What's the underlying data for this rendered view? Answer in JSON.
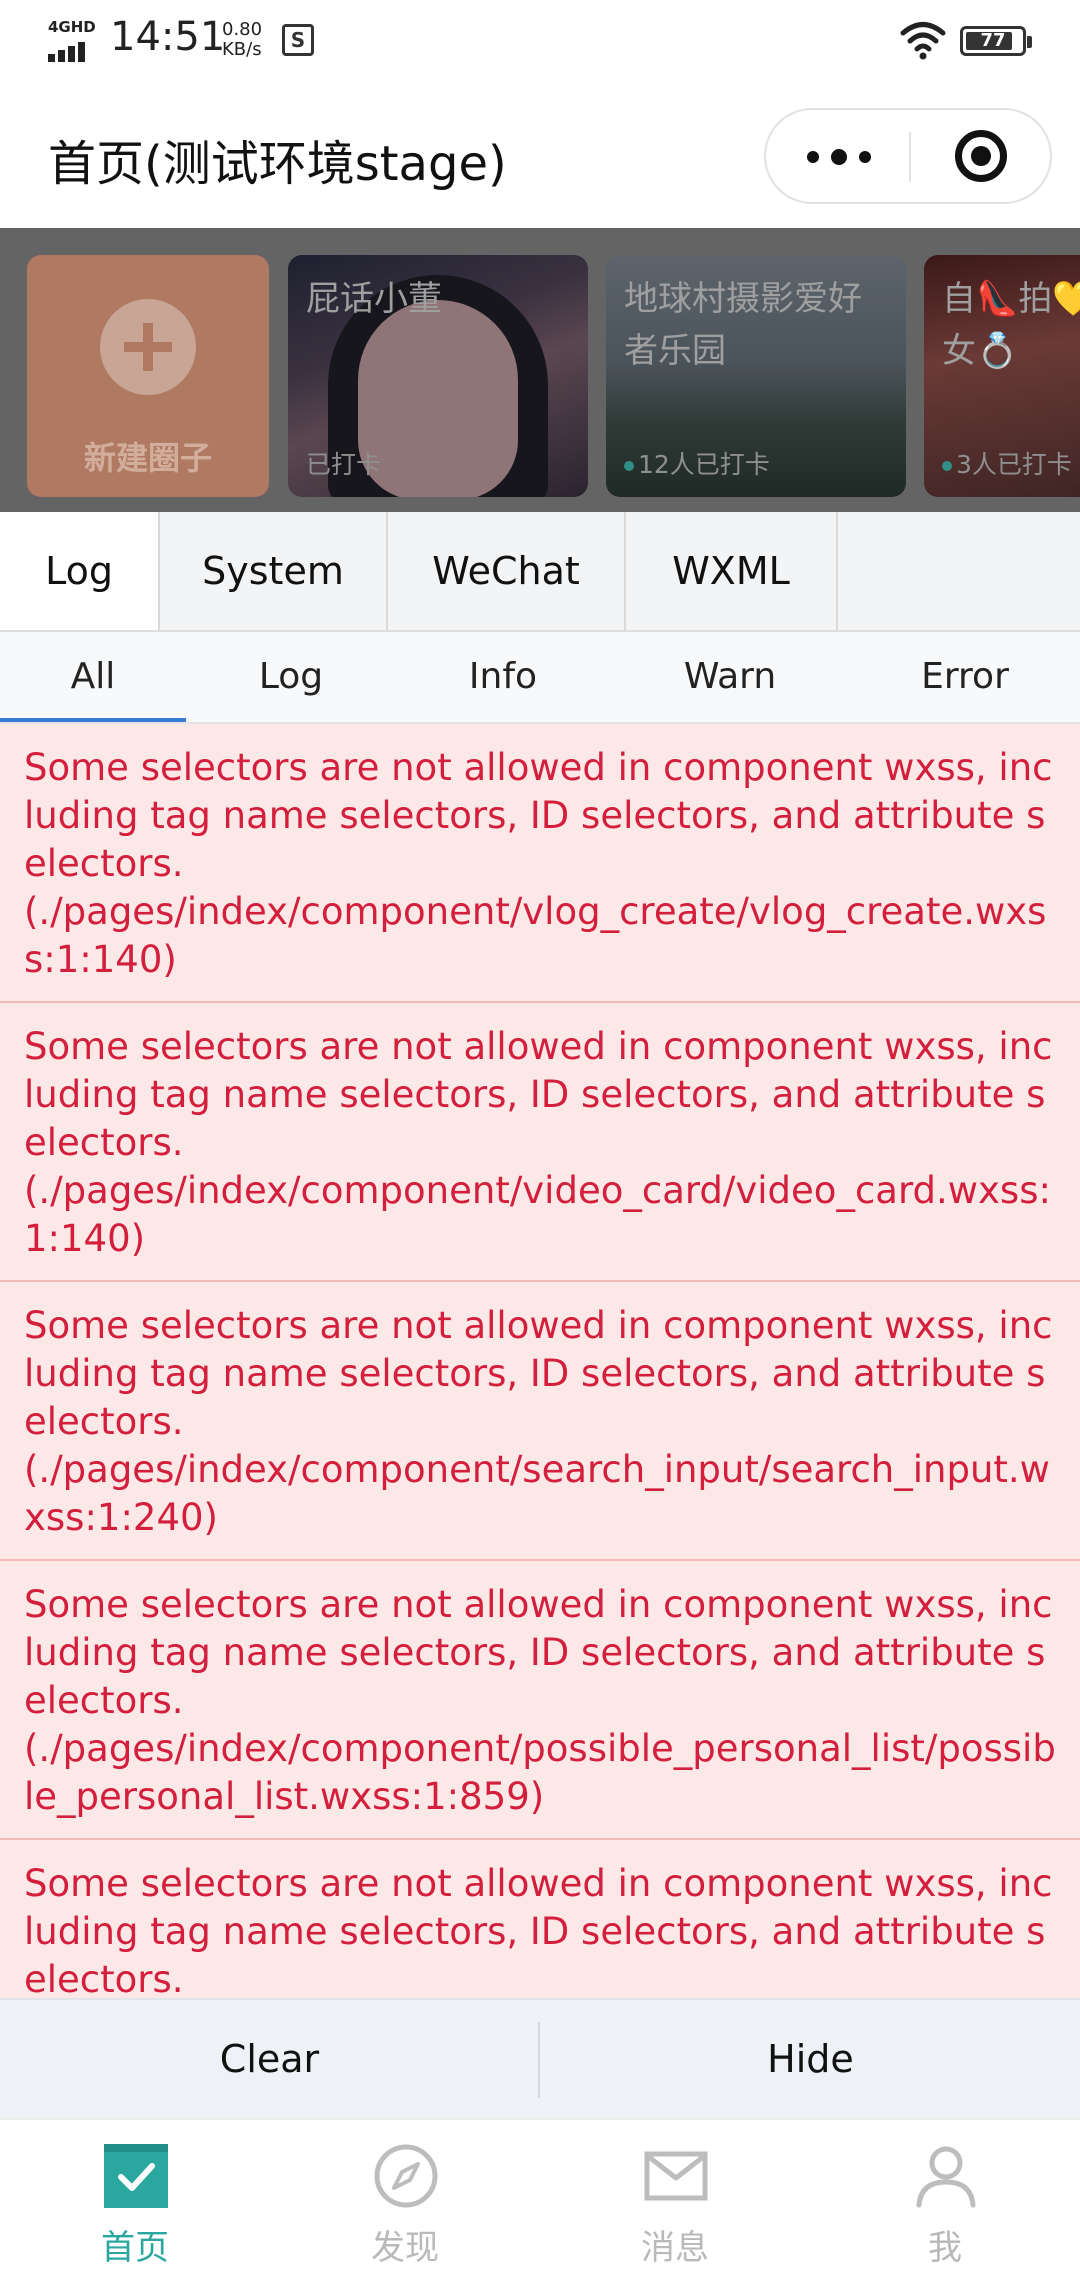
{
  "status_bar": {
    "network": "4GHD",
    "time": "14:51",
    "speed_value": "0.80",
    "speed_unit": "KB/s",
    "notification_glyph": "S",
    "battery": "77"
  },
  "header": {
    "title": "首页(测试环境stage)",
    "more_icon": "more-dots-icon",
    "close_icon": "target-icon"
  },
  "circles": {
    "new_label": "新建圈子",
    "cards": [
      {
        "title": "屁话小董",
        "stat": "已打卡",
        "has_dot": false
      },
      {
        "title": "地球村摄影爱好者乐园",
        "stat": "12人已打卡",
        "has_dot": true
      },
      {
        "title": "自👠拍💛女💍",
        "stat": "3人已打卡",
        "has_dot": true
      }
    ]
  },
  "console": {
    "tabs": [
      "Log",
      "System",
      "WeChat",
      "WXML"
    ],
    "active_tab": "Log",
    "subtabs": [
      "All",
      "Log",
      "Info",
      "Warn",
      "Error"
    ],
    "active_subtab": "All",
    "logs": [
      {
        "message": "Some selectors are not allowed in component wxss, including tag name selectors, ID selectors, and attribute selectors.",
        "source": "(./pages/index/component/vlog_create/vlog_create.wxss:1:140)"
      },
      {
        "message": "Some selectors are not allowed in component wxss, including tag name selectors, ID selectors, and attribute selectors.",
        "source": "(./pages/index/component/video_card/video_card.wxss:1:140)"
      },
      {
        "message": "Some selectors are not allowed in component wxss, including tag name selectors, ID selectors, and attribute selectors.",
        "source": "(./pages/index/component/search_input/search_input.wxss:1:240)"
      },
      {
        "message": "Some selectors are not allowed in component wxss, including tag name selectors, ID selectors, and attribute selectors.",
        "source": "(./pages/index/component/possible_personal_list/possible_personal_list.wxss:1:859)"
      },
      {
        "message": "Some selectors are not allowed in component wxss, including tag name selectors, ID selectors, and attribute selectors.",
        "source": ""
      }
    ],
    "clear_label": "Clear",
    "hide_label": "Hide",
    "error_color": "#d31f3b"
  },
  "bottom_nav": {
    "active_color": "#2aa8a0",
    "items": [
      {
        "label": "首页",
        "icon": "home-check-icon"
      },
      {
        "label": "发现",
        "icon": "compass-icon"
      },
      {
        "label": "消息",
        "icon": "mail-icon"
      },
      {
        "label": "我",
        "icon": "user-icon"
      }
    ]
  }
}
